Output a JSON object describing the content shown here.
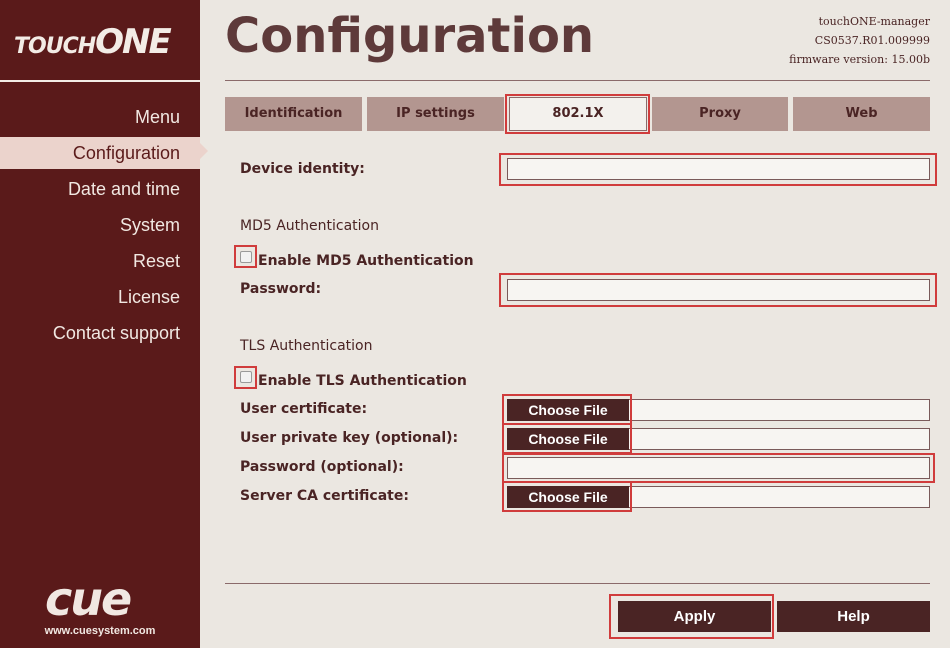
{
  "brand": {
    "logo_small": "TOUCH",
    "logo_big": "ONE",
    "footer_logo": "cue",
    "footer_url": "www.cuesystem.com"
  },
  "sidebar": {
    "items": [
      {
        "label": "Menu"
      },
      {
        "label": "Configuration"
      },
      {
        "label": "Date and time"
      },
      {
        "label": "System"
      },
      {
        "label": "Reset"
      },
      {
        "label": "License"
      },
      {
        "label": "Contact support"
      }
    ]
  },
  "header": {
    "title": "Configuration",
    "device_name": "touchONE-manager",
    "device_id": "CS0537.R01.009999",
    "firmware": "firmware version: 15.00b"
  },
  "tabs": [
    {
      "label": "Identification"
    },
    {
      "label": "IP settings"
    },
    {
      "label": "802.1X"
    },
    {
      "label": "Proxy"
    },
    {
      "label": "Web"
    }
  ],
  "form": {
    "device_identity_label": "Device identity:",
    "device_identity_value": "",
    "md5_title": "MD5 Authentication",
    "md5_enable_label": "Enable MD5 Authentication",
    "md5_password_label": "Password:",
    "md5_password_value": "",
    "tls_title": "TLS Authentication",
    "tls_enable_label": "Enable TLS Authentication",
    "user_cert_label": "User certificate:",
    "user_key_label": "User private key (optional):",
    "tls_password_label": "Password (optional):",
    "tls_password_value": "",
    "server_ca_label": "Server CA certificate:",
    "choose_file": "Choose File"
  },
  "actions": {
    "apply": "Apply",
    "help": "Help"
  },
  "colors": {
    "sidebar": "#5a1a1a",
    "tab": "#b39690",
    "button": "#4a2424",
    "highlight": "#d03c3c"
  }
}
